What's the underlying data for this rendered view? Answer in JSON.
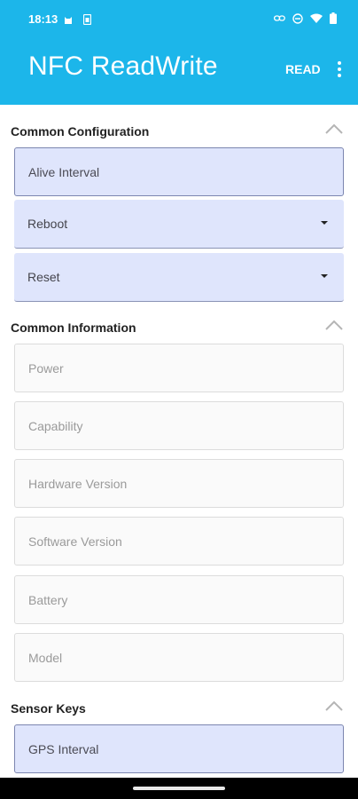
{
  "status_bar": {
    "time": "18:13",
    "icons_left": [
      "cat-icon",
      "sim-icon"
    ],
    "icons_right": [
      "link-icon",
      "dnd-icon",
      "wifi-icon",
      "battery-icon"
    ]
  },
  "app_bar": {
    "title": "NFC ReadWrite",
    "read_label": "READ",
    "menu_icon": "more-vert-icon",
    "color": "#1cb6ea"
  },
  "sections": {
    "common_configuration": {
      "title": "Common Configuration",
      "fields": {
        "alive_interval": "Alive Interval",
        "reboot": "Reboot",
        "reset": "Reset"
      }
    },
    "common_information": {
      "title": "Common Information",
      "fields": {
        "power": "Power",
        "capability": "Capability",
        "hardware_version": "Hardware Version",
        "software_version": "Software Version",
        "battery": "Battery",
        "model": "Model"
      }
    },
    "sensor_keys": {
      "title": "Sensor Keys",
      "fields": {
        "gps_interval": "GPS Interval"
      }
    }
  },
  "colors": {
    "field_fill": "#dfe5fc",
    "disabled_fill": "#fafafa"
  }
}
